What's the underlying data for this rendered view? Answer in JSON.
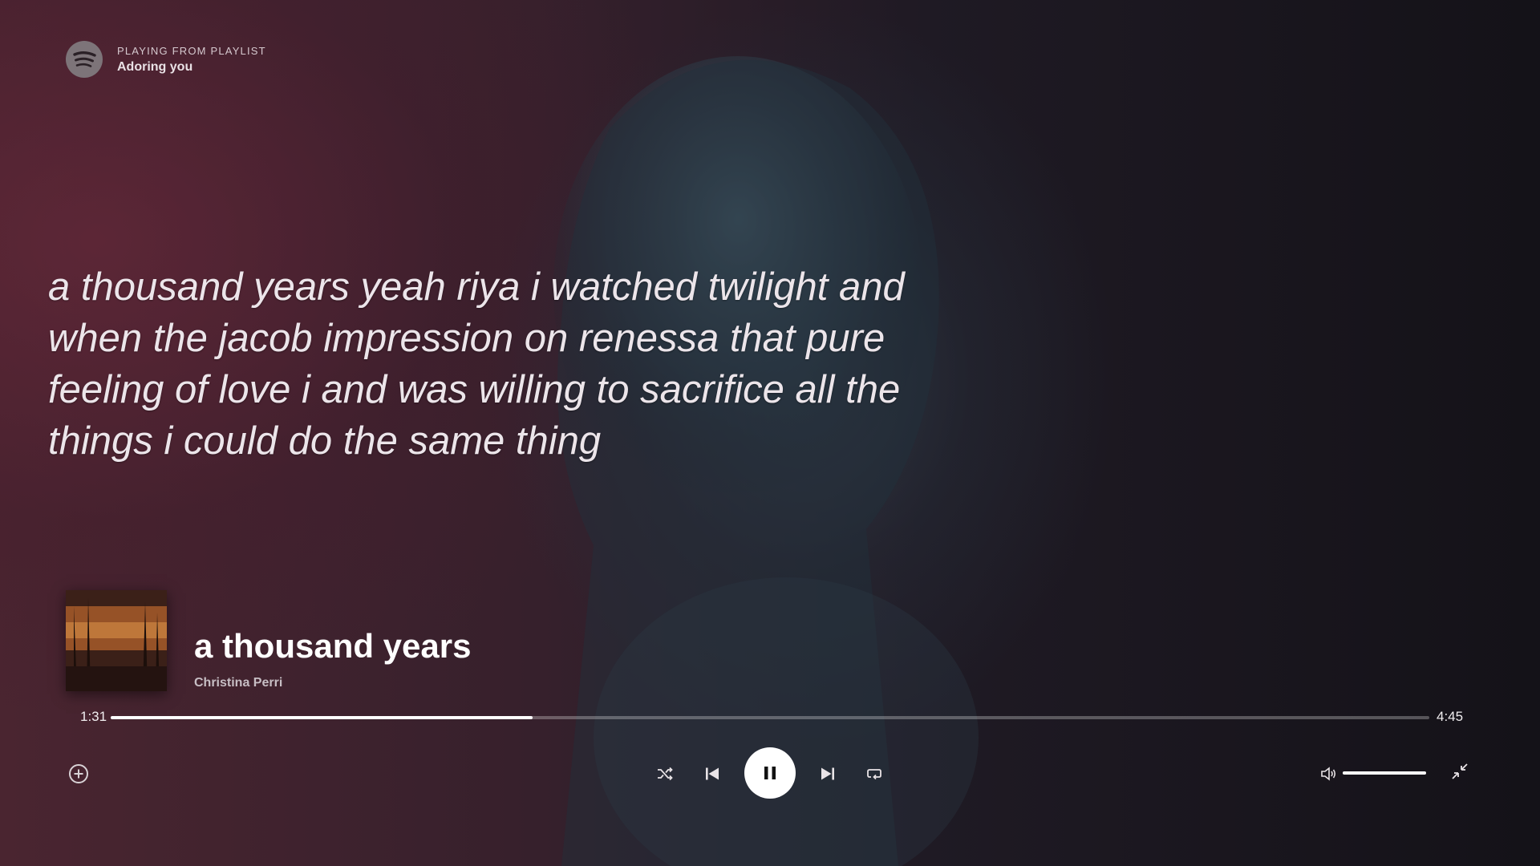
{
  "header": {
    "label": "PLAYING FROM PLAYLIST",
    "playlist": "Adoring you",
    "logo_icon": "spotify-logo-icon"
  },
  "lyrics": {
    "lines": [
      "a thousand years yeah riya i watched twilight and",
      "when the jacob impression on renessa that pure",
      "feeling of love i and was willing to sacrifice all the",
      "things i could do the same thing"
    ]
  },
  "track": {
    "title": "a thousand years",
    "artist": "Christina Perri",
    "album_art_icon": "album-art-breaking-dawn"
  },
  "playback": {
    "current_time": "1:31",
    "total_time": "4:45",
    "progress_fraction": 0.32,
    "state": "playing"
  },
  "volume": {
    "level_fraction": 1.0
  },
  "icons": {
    "add": "add-circle-icon",
    "shuffle": "shuffle-icon",
    "previous": "skip-previous-icon",
    "pause": "pause-icon",
    "next": "skip-next-icon",
    "repeat": "repeat-icon",
    "volume": "volume-icon",
    "minimize": "minimize-icon"
  },
  "colors": {
    "accent": "#ffffff",
    "background_left": "#4a2530",
    "background_right": "#141218"
  }
}
